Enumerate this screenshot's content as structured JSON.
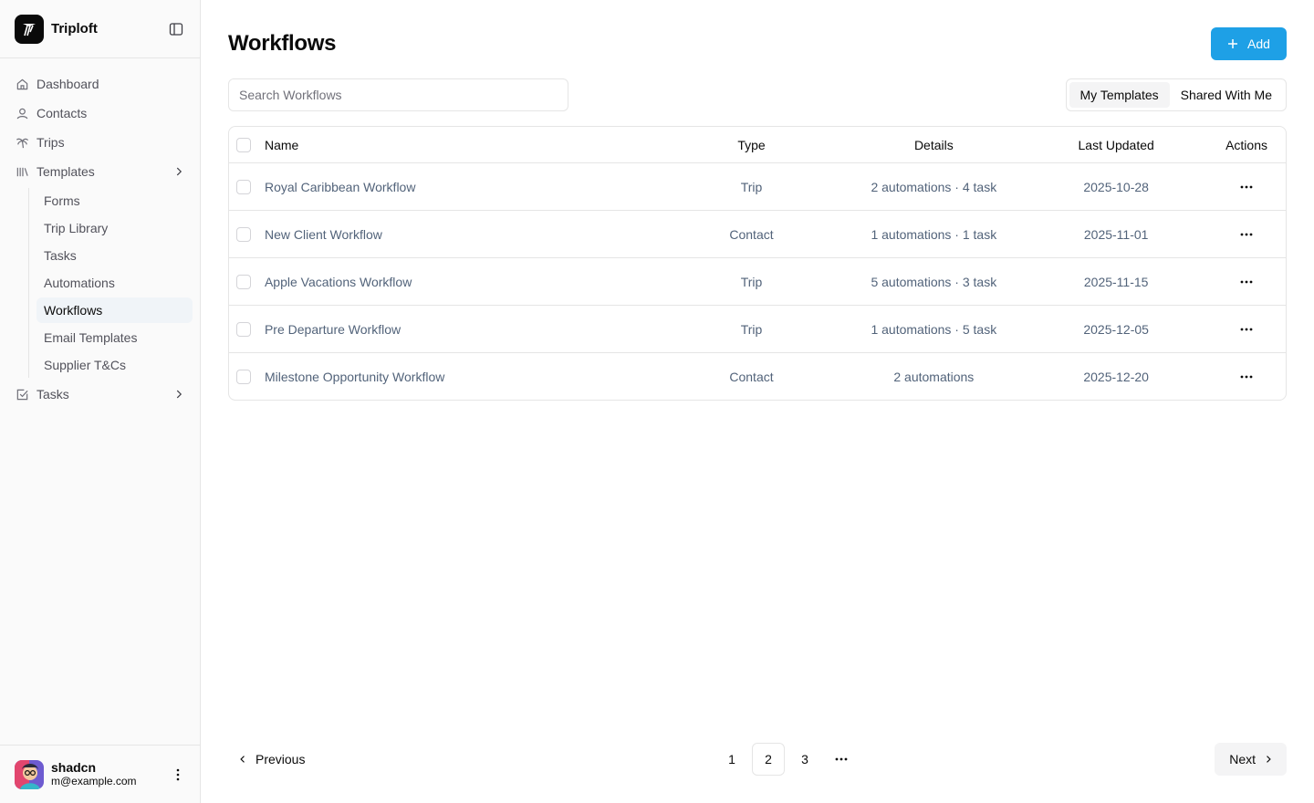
{
  "app": {
    "name": "Triploft"
  },
  "sidebar": {
    "items": [
      {
        "label": "Dashboard",
        "icon": "home-icon"
      },
      {
        "label": "Contacts",
        "icon": "user-icon"
      },
      {
        "label": "Trips",
        "icon": "palm-tree-icon"
      },
      {
        "label": "Templates",
        "icon": "library-icon"
      },
      {
        "label": "Tasks",
        "icon": "square-check-icon"
      }
    ],
    "templates_sub": [
      "Forms",
      "Trip Library",
      "Tasks",
      "Automations",
      "Workflows",
      "Email Templates",
      "Supplier T&Cs"
    ],
    "active_sub": "Workflows"
  },
  "user": {
    "name": "shadcn",
    "email": "m@example.com"
  },
  "header": {
    "title": "Workflows",
    "add_label": "Add"
  },
  "search": {
    "placeholder": "Search Workflows",
    "value": ""
  },
  "toggle": {
    "options": [
      "My Templates",
      "Shared With Me"
    ],
    "selected": "My Templates"
  },
  "table": {
    "columns": [
      "Name",
      "Type",
      "Details",
      "Last Updated",
      "Actions"
    ],
    "rows": [
      {
        "name": "Royal Caribbean Workflow",
        "type": "Trip",
        "details": "2 automations · 4 task",
        "updated": "2025-10-28"
      },
      {
        "name": "New Client Workflow",
        "type": "Contact",
        "details": "1 automations · 1 task",
        "updated": "2025-11-01"
      },
      {
        "name": "Apple Vacations Workflow",
        "type": "Trip",
        "details": "5 automations · 3 task",
        "updated": "2025-11-15"
      },
      {
        "name": "Pre Departure Workflow",
        "type": "Trip",
        "details": "1 automations · 5 task",
        "updated": "2025-12-05"
      },
      {
        "name": "Milestone Opportunity Workflow",
        "type": "Contact",
        "details": "2 automations",
        "updated": "2025-12-20"
      }
    ]
  },
  "pagination": {
    "previous": "Previous",
    "next": "Next",
    "pages": [
      "1",
      "2",
      "3"
    ],
    "current": "2"
  },
  "colors": {
    "accent": "#1ea0e6",
    "muted_text": "#52637a",
    "active_bg": "#f0f4f8"
  }
}
